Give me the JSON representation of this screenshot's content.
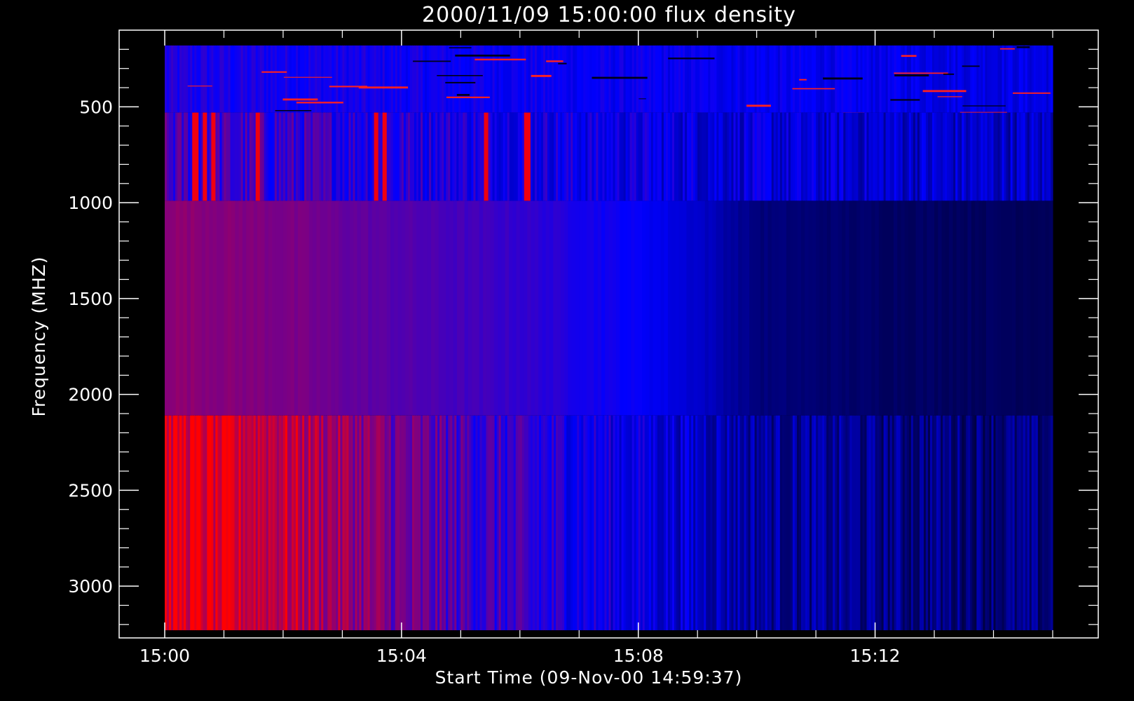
{
  "chart_data": {
    "type": "heatmap",
    "title": "2000/11/09 15:00:00 flux density",
    "xlabel": "Start Time (09-Nov-00 14:59:37)",
    "ylabel": "Frequency (MHZ)",
    "x_tick_labels": [
      "15:00",
      "15:04",
      "15:08",
      "15:12"
    ],
    "x_ticks_minutes": [
      0,
      4,
      8,
      12
    ],
    "y_tick_values": [
      500,
      1000,
      1500,
      2000,
      2500,
      3000
    ],
    "y_tick_labels": [
      "500",
      "1000",
      "1500",
      "2000",
      "2500",
      "3000"
    ],
    "xlim_minutes": [
      -0.77,
      15.77
    ],
    "ylim_mhz": [
      3270,
      100
    ],
    "data_extent_minutes": [
      0,
      15
    ],
    "grid": false,
    "colormap": [
      "#000000",
      "#0000ff",
      "#ff0000"
    ],
    "background": "#000000",
    "foreground": "#ffffff",
    "bands": [
      {
        "name": "",
        "freq_range_mhz": [
          180,
          530
        ],
        "texture": "striated",
        "intensity_profile": [
          {
            "t": 0,
            "v": 0.55
          },
          {
            "t": 7,
            "v": 0.5
          },
          {
            "t": 15,
            "v": 0.45
          }
        ]
      },
      {
        "name": "",
        "freq_range_mhz": [
          530,
          990
        ],
        "texture": "vertical-streaks",
        "intensity_profile": [
          {
            "t": 0,
            "v": 0.62
          },
          {
            "t": 2,
            "v": 0.6
          },
          {
            "t": 4,
            "v": 0.56
          },
          {
            "t": 7,
            "v": 0.5
          },
          {
            "t": 9,
            "v": 0.45
          },
          {
            "t": 11,
            "v": 0.42
          },
          {
            "t": 15,
            "v": 0.38
          }
        ],
        "bursts_minutes": [
          0.5,
          0.65,
          0.8,
          1.55,
          3.55,
          3.7,
          5.4,
          6.1
        ]
      },
      {
        "name": "",
        "freq_range_mhz": [
          990,
          2110
        ],
        "texture": "smooth",
        "intensity_profile": [
          {
            "t": 0,
            "v": 0.78
          },
          {
            "t": 2,
            "v": 0.74
          },
          {
            "t": 4,
            "v": 0.66
          },
          {
            "t": 6,
            "v": 0.6
          },
          {
            "t": 8,
            "v": 0.5
          },
          {
            "t": 9,
            "v": 0.4
          },
          {
            "t": 10,
            "v": 0.24
          },
          {
            "t": 12,
            "v": 0.2
          },
          {
            "t": 15,
            "v": 0.18
          }
        ]
      },
      {
        "name": "",
        "freq_range_mhz": [
          2110,
          3230
        ],
        "texture": "vertical-streaks",
        "intensity_profile": [
          {
            "t": 0,
            "v": 0.95
          },
          {
            "t": 2,
            "v": 0.88
          },
          {
            "t": 3,
            "v": 0.8
          },
          {
            "t": 4,
            "v": 0.7
          },
          {
            "t": 6,
            "v": 0.58
          },
          {
            "t": 8,
            "v": 0.47
          },
          {
            "t": 10,
            "v": 0.32
          },
          {
            "t": 12,
            "v": 0.27
          },
          {
            "t": 15,
            "v": 0.24
          }
        ]
      }
    ]
  }
}
